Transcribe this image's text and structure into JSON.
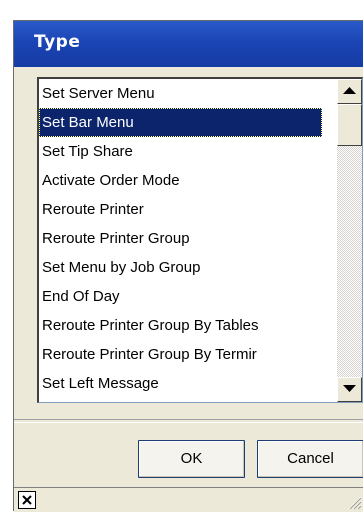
{
  "dialog": {
    "title": "Type"
  },
  "list": {
    "items": [
      "Set Server Menu",
      "Set Bar Menu",
      "Set Tip Share",
      "Activate Order Mode",
      "Reroute Printer",
      "Reroute Printer Group",
      "Set Menu by Job Group",
      "End Of Day",
      "Reroute Printer Group By Tables",
      "Reroute Printer Group By Termir",
      "Set Left Message"
    ],
    "selected_index": 1
  },
  "buttons": {
    "ok_label": "OK",
    "cancel_label": "Cancel"
  },
  "icons": {
    "scroll_up": "triangle-up-icon",
    "scroll_down": "triangle-down-icon",
    "close": "close-icon",
    "resize_grip": "resize-grip-icon"
  },
  "colors": {
    "titlebar": "#1b45b5",
    "selection": "#0b246b",
    "dialog_bg": "#ece9d8"
  }
}
